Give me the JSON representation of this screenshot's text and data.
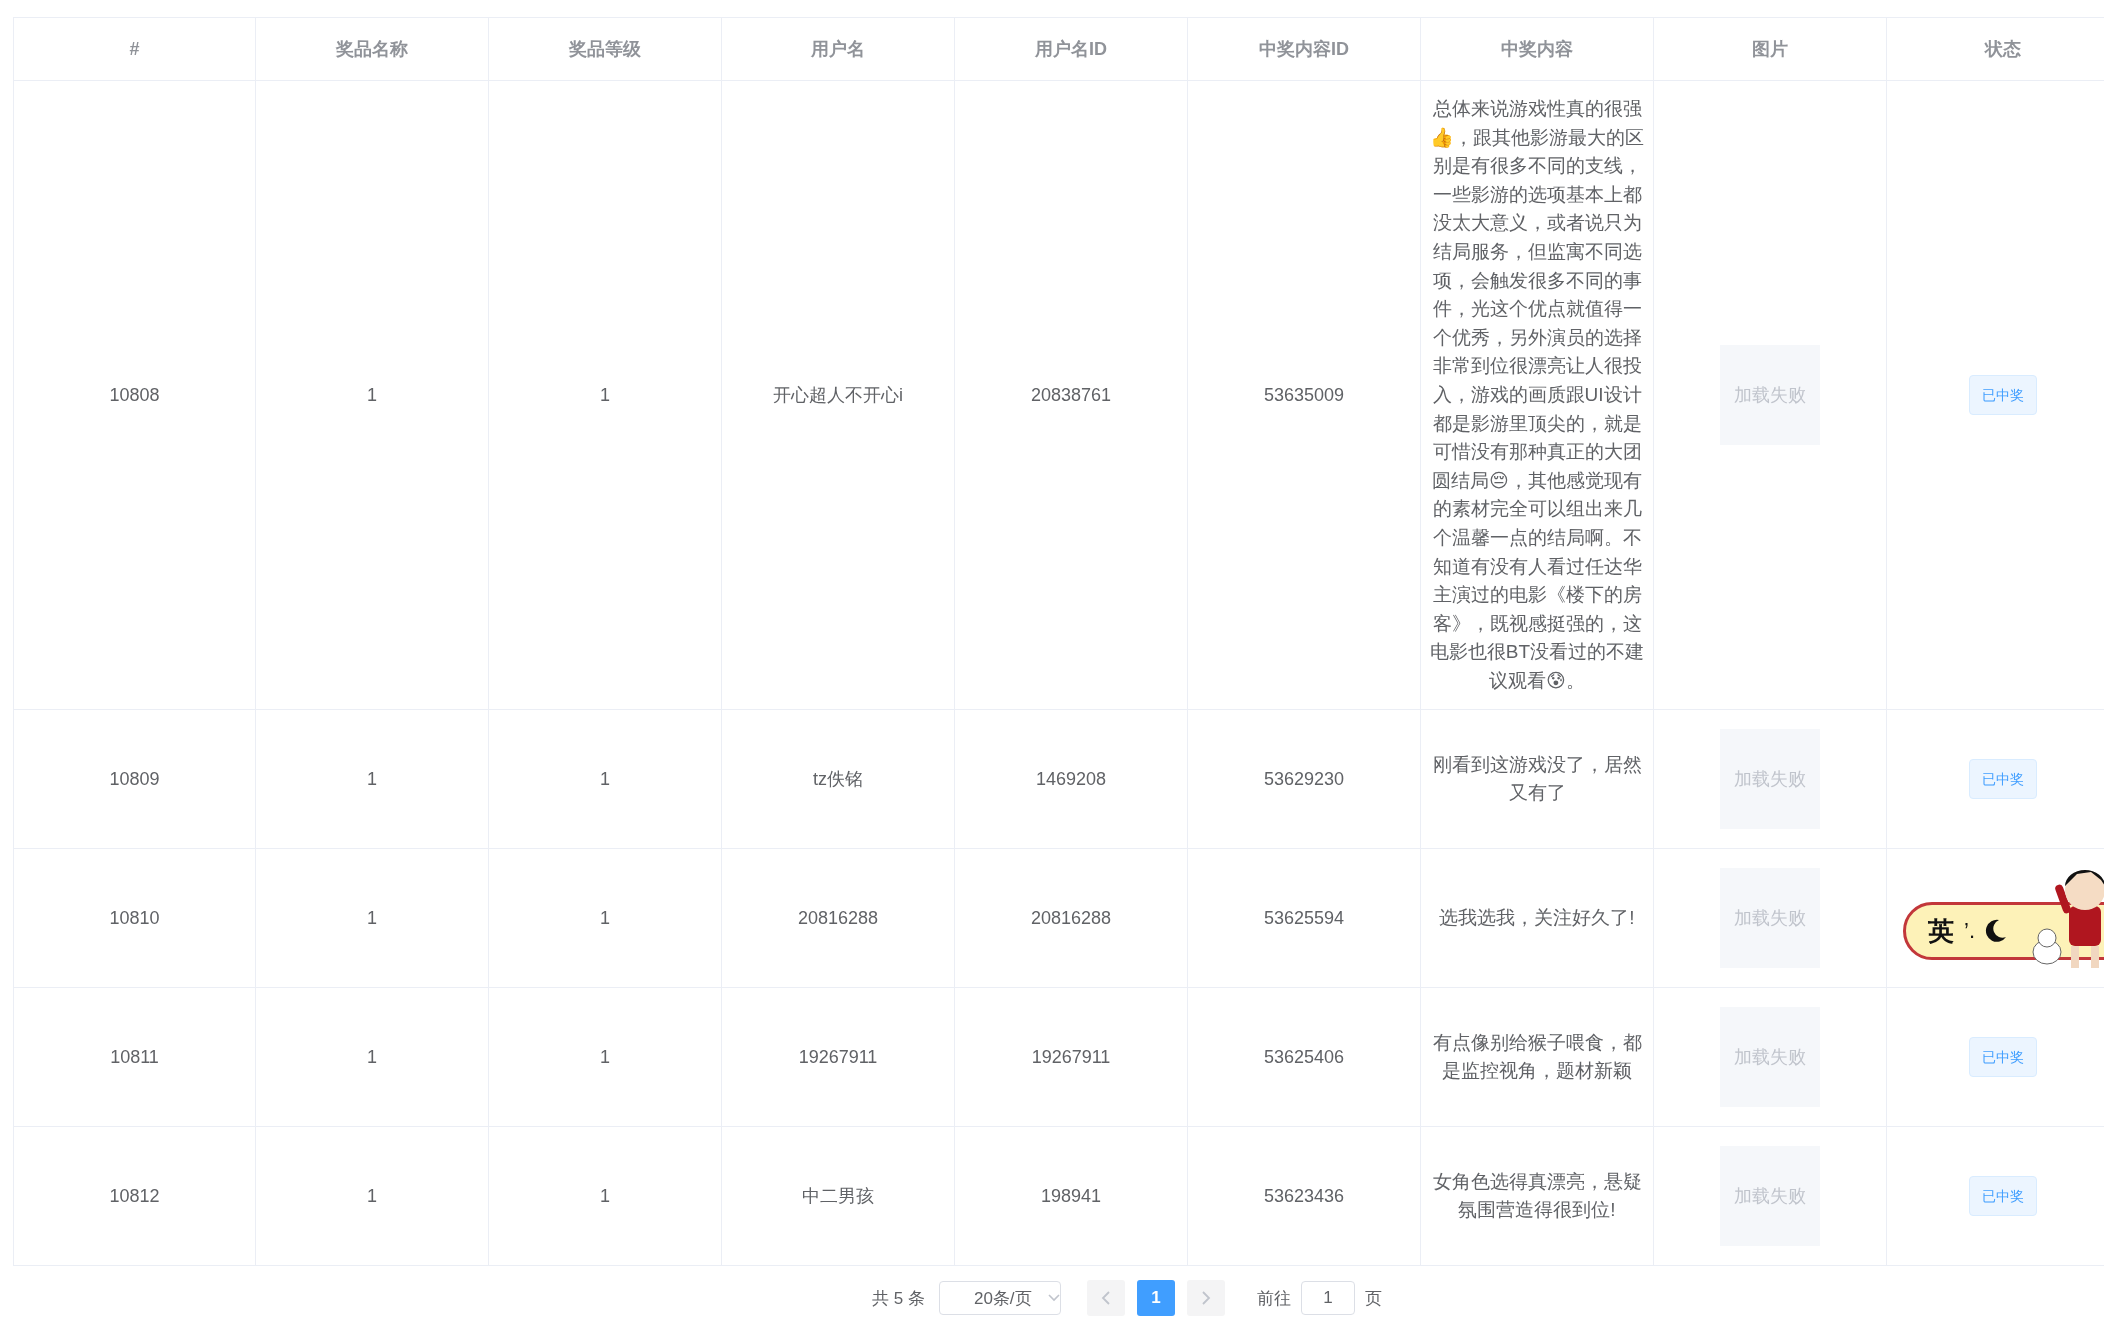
{
  "table": {
    "columns": [
      "#",
      "奖品名称",
      "奖品等级",
      "用户名",
      "用户名ID",
      "中奖内容ID",
      "中奖内容",
      "图片",
      "状态"
    ],
    "rows": [
      {
        "id": "10808",
        "prize_name": "1",
        "prize_level": "1",
        "username": "开心超人不开心i",
        "user_id": "20838761",
        "content_id": "53635009",
        "content": "总体来说游戏性真的很强👍，跟其他影游最大的区别是有很多不同的支线，一些影游的选项基本上都没太大意义，或者说只为结局服务，但监寓不同选项，会触发很多不同的事件，光这个优点就值得一个优秀，另外演员的选择非常到位很漂亮让人很投入，游戏的画质跟UI设计都是影游里顶尖的，就是可惜没有那种真正的大团圆结局😔，其他感觉现有的素材完全可以组出来几个温馨一点的结局啊。不知道有没有人看过任达华主演过的电影《楼下的房客》，既视感挺强的，这电影也很BT没看过的不建议观看😰。",
        "image": "加载失败",
        "status": "已中奖"
      },
      {
        "id": "10809",
        "prize_name": "1",
        "prize_level": "1",
        "username": "tz佚铭",
        "user_id": "1469208",
        "content_id": "53629230",
        "content": "刚看到这游戏没了，居然又有了",
        "image": "加载失败",
        "status": "已中奖"
      },
      {
        "id": "10810",
        "prize_name": "1",
        "prize_level": "1",
        "username": "20816288",
        "user_id": "20816288",
        "content_id": "53625594",
        "content": "选我选我，关注好久了!",
        "image": "加载失败"
      },
      {
        "id": "10811",
        "prize_name": "1",
        "prize_level": "1",
        "username": "19267911",
        "user_id": "19267911",
        "content_id": "53625406",
        "content": "有点像别给猴子喂食，都是监控视角，题材新颖",
        "image": "加载失败",
        "status": "已中奖"
      },
      {
        "id": "10812",
        "prize_name": "1",
        "prize_level": "1",
        "username": "中二男孩",
        "user_id": "198941",
        "content_id": "53623436",
        "content": "女角色选得真漂亮，悬疑氛围营造得很到位!",
        "image": "加载失败",
        "status": "已中奖"
      }
    ]
  },
  "pagination": {
    "total": "共 5 条",
    "page_size": "20条/页",
    "pages": [
      {
        "label": "1",
        "selected": true
      }
    ],
    "goto_label": "前往",
    "goto_value": "1",
    "page_unit": "页"
  },
  "ime_widget": {
    "mode": "英",
    "punct": "’."
  }
}
